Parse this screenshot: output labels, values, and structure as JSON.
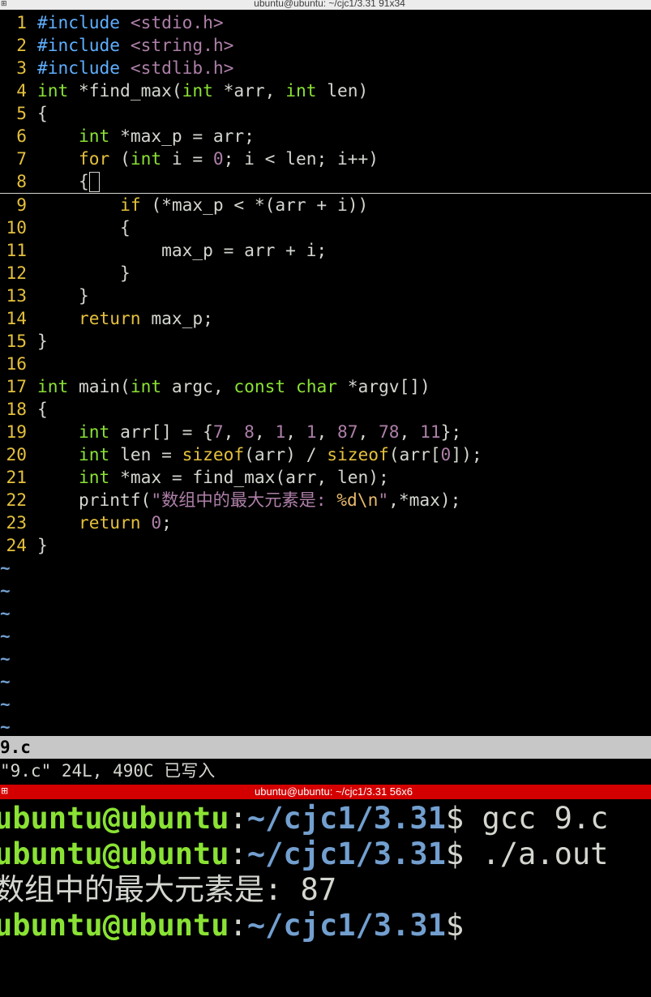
{
  "window_title": "ubuntu@ubuntu: ~/cjc1/3.31 91x34",
  "editor": {
    "lines": [
      {
        "n": "1",
        "segs": [
          [
            "k-pre",
            "#include "
          ],
          [
            "k-str",
            "<stdio.h>"
          ]
        ]
      },
      {
        "n": "2",
        "segs": [
          [
            "k-pre",
            "#include "
          ],
          [
            "k-str",
            "<string.h>"
          ]
        ]
      },
      {
        "n": "3",
        "segs": [
          [
            "k-pre",
            "#include "
          ],
          [
            "k-str",
            "<stdlib.h>"
          ]
        ]
      },
      {
        "n": "4",
        "segs": [
          [
            "k-type",
            "int"
          ],
          [
            "",
            " *find_max("
          ],
          [
            "k-type",
            "int"
          ],
          [
            "",
            " *arr, "
          ],
          [
            "k-type",
            "int"
          ],
          [
            "",
            " len)"
          ]
        ]
      },
      {
        "n": "5",
        "segs": [
          [
            "",
            "{"
          ]
        ]
      },
      {
        "n": "6",
        "segs": [
          [
            "",
            "    "
          ],
          [
            "k-type",
            "int"
          ],
          [
            "",
            " *max_p = arr;"
          ]
        ]
      },
      {
        "n": "7",
        "segs": [
          [
            "",
            "    "
          ],
          [
            "k-ctl",
            "for"
          ],
          [
            "",
            " ("
          ],
          [
            "k-type",
            "int"
          ],
          [
            "",
            " i = "
          ],
          [
            "k-num",
            "0"
          ],
          [
            "",
            "; i < len; i++)"
          ]
        ]
      },
      {
        "n": "8",
        "segs": [
          [
            "",
            "    {"
          ]
        ],
        "cursor": true
      },
      {
        "n": "9",
        "segs": [
          [
            "",
            "        "
          ],
          [
            "k-ctl",
            "if"
          ],
          [
            "",
            " (*max_p < *(arr + i))"
          ]
        ]
      },
      {
        "n": "10",
        "segs": [
          [
            "",
            "        {"
          ]
        ]
      },
      {
        "n": "11",
        "segs": [
          [
            "",
            "            max_p = arr + i;"
          ]
        ]
      },
      {
        "n": "12",
        "segs": [
          [
            "",
            "        }"
          ]
        ]
      },
      {
        "n": "13",
        "segs": [
          [
            "",
            "    }"
          ]
        ]
      },
      {
        "n": "14",
        "segs": [
          [
            "",
            "    "
          ],
          [
            "k-ctl",
            "return"
          ],
          [
            "",
            " max_p;"
          ]
        ]
      },
      {
        "n": "15",
        "segs": [
          [
            "",
            "}"
          ]
        ]
      },
      {
        "n": "16",
        "segs": []
      },
      {
        "n": "17",
        "segs": [
          [
            "k-type",
            "int"
          ],
          [
            "",
            " main("
          ],
          [
            "k-type",
            "int"
          ],
          [
            "",
            " argc, "
          ],
          [
            "k-type",
            "const"
          ],
          [
            "",
            " "
          ],
          [
            "k-type",
            "char"
          ],
          [
            "",
            " *argv[])"
          ]
        ]
      },
      {
        "n": "18",
        "segs": [
          [
            "",
            "{"
          ]
        ]
      },
      {
        "n": "19",
        "segs": [
          [
            "",
            "    "
          ],
          [
            "k-type",
            "int"
          ],
          [
            "",
            " arr[] = {"
          ],
          [
            "k-num",
            "7"
          ],
          [
            "",
            ", "
          ],
          [
            "k-num",
            "8"
          ],
          [
            "",
            ", "
          ],
          [
            "k-num",
            "1"
          ],
          [
            "",
            ", "
          ],
          [
            "k-num",
            "1"
          ],
          [
            "",
            ", "
          ],
          [
            "k-num",
            "87"
          ],
          [
            "",
            ", "
          ],
          [
            "k-num",
            "78"
          ],
          [
            "",
            ", "
          ],
          [
            "k-num",
            "11"
          ],
          [
            "",
            "};"
          ]
        ]
      },
      {
        "n": "20",
        "segs": [
          [
            "",
            "    "
          ],
          [
            "k-type",
            "int"
          ],
          [
            "",
            " len = "
          ],
          [
            "k-ctl",
            "sizeof"
          ],
          [
            "",
            "(arr) / "
          ],
          [
            "k-ctl",
            "sizeof"
          ],
          [
            "",
            "(arr["
          ],
          [
            "k-num",
            "0"
          ],
          [
            "",
            "]);"
          ]
        ]
      },
      {
        "n": "21",
        "segs": [
          [
            "",
            "    "
          ],
          [
            "k-type",
            "int"
          ],
          [
            "",
            " *max = find_max(arr, len);"
          ]
        ]
      },
      {
        "n": "22",
        "segs": [
          [
            "",
            "    printf("
          ],
          [
            "k-str",
            "\"数组中的最大元素是: "
          ],
          [
            "k-esc",
            "%d\\n"
          ],
          [
            "k-str",
            "\""
          ],
          [
            "",
            ",*max);"
          ]
        ]
      },
      {
        "n": "23",
        "segs": [
          [
            "",
            "    "
          ],
          [
            "k-ctl",
            "return"
          ],
          [
            "",
            " "
          ],
          [
            "k-num",
            "0"
          ],
          [
            "",
            ";"
          ]
        ]
      },
      {
        "n": "24",
        "segs": [
          [
            "",
            "}"
          ]
        ]
      }
    ],
    "tilde_char": "~",
    "tilde_count": 8
  },
  "status": {
    "filename": "9.c",
    "message": "\"9.c\" 24L, 490C 已写入"
  },
  "terminal2": {
    "title": "ubuntu@ubuntu: ~/cjc1/3.31 56x6",
    "prompt_user": "ubuntu@ubuntu",
    "prompt_sep": ":",
    "prompt_path": "~/cjc1/3.31",
    "prompt_sym": "$",
    "cmd1": " gcc 9.c",
    "cmd2": " ./a.out",
    "output": "数组中的最大元素是: 87"
  }
}
